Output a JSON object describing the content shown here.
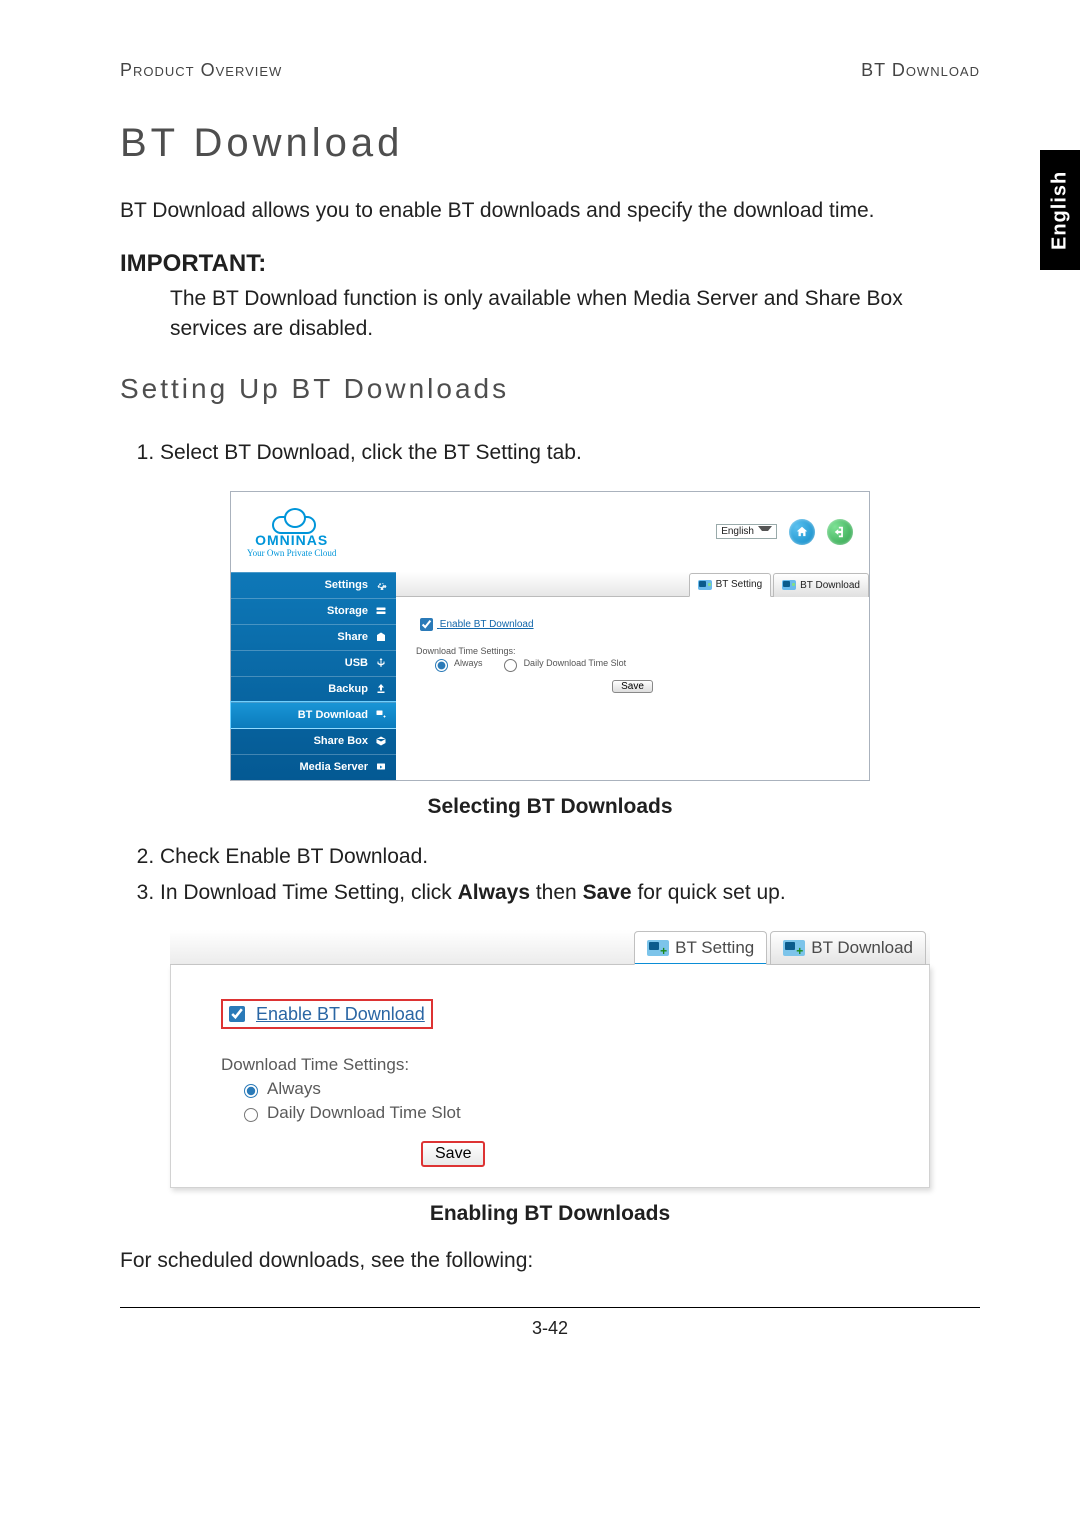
{
  "header": {
    "left": "Product Overview",
    "right": "BT Download"
  },
  "langtab": "English",
  "title": "BT Download",
  "intro": "BT Download allows you to enable BT downloads and specify the download time.",
  "important": {
    "heading": "IMPORTANT:",
    "text": "The BT Download function is only available when Media Server and Share Box services are disabled."
  },
  "subheading": "Setting Up BT Downloads",
  "step1": "Select BT Download, click the BT Setting tab.",
  "step2": "Check Enable BT Download.",
  "step3_pre": "In Download Time Setting, click ",
  "step3_b1": "Always",
  "step3_mid": " then ",
  "step3_b2": "Save",
  "step3_post": " for quick set up.",
  "caption1": "Selecting BT Downloads",
  "caption2": "Enabling BT Downloads",
  "closing": "For scheduled downloads, see the following:",
  "pagenum": "3-42",
  "fig1": {
    "logo_word": "OMNINAS",
    "logo_tag": "Your Own Private Cloud",
    "lang_value": "English",
    "sidebar": [
      "Settings",
      "Storage",
      "Share",
      "USB",
      "Backup",
      "BT Download",
      "Share Box",
      "Media Server"
    ],
    "tabs": {
      "setting": "BT Setting",
      "download": "BT Download"
    },
    "enable_label": "Enable BT Download",
    "dtsettings_label": "Download Time Settings:",
    "opt_always": "Always",
    "opt_daily": "Daily Download Time Slot",
    "save": "Save"
  },
  "fig2": {
    "tabs": {
      "setting": "BT Setting",
      "download": "BT Download"
    },
    "enable_label": "Enable BT Download",
    "dtsettings_label": "Download Time Settings:",
    "opt_always": "Always",
    "opt_daily": "Daily Download Time Slot",
    "save": "Save"
  }
}
